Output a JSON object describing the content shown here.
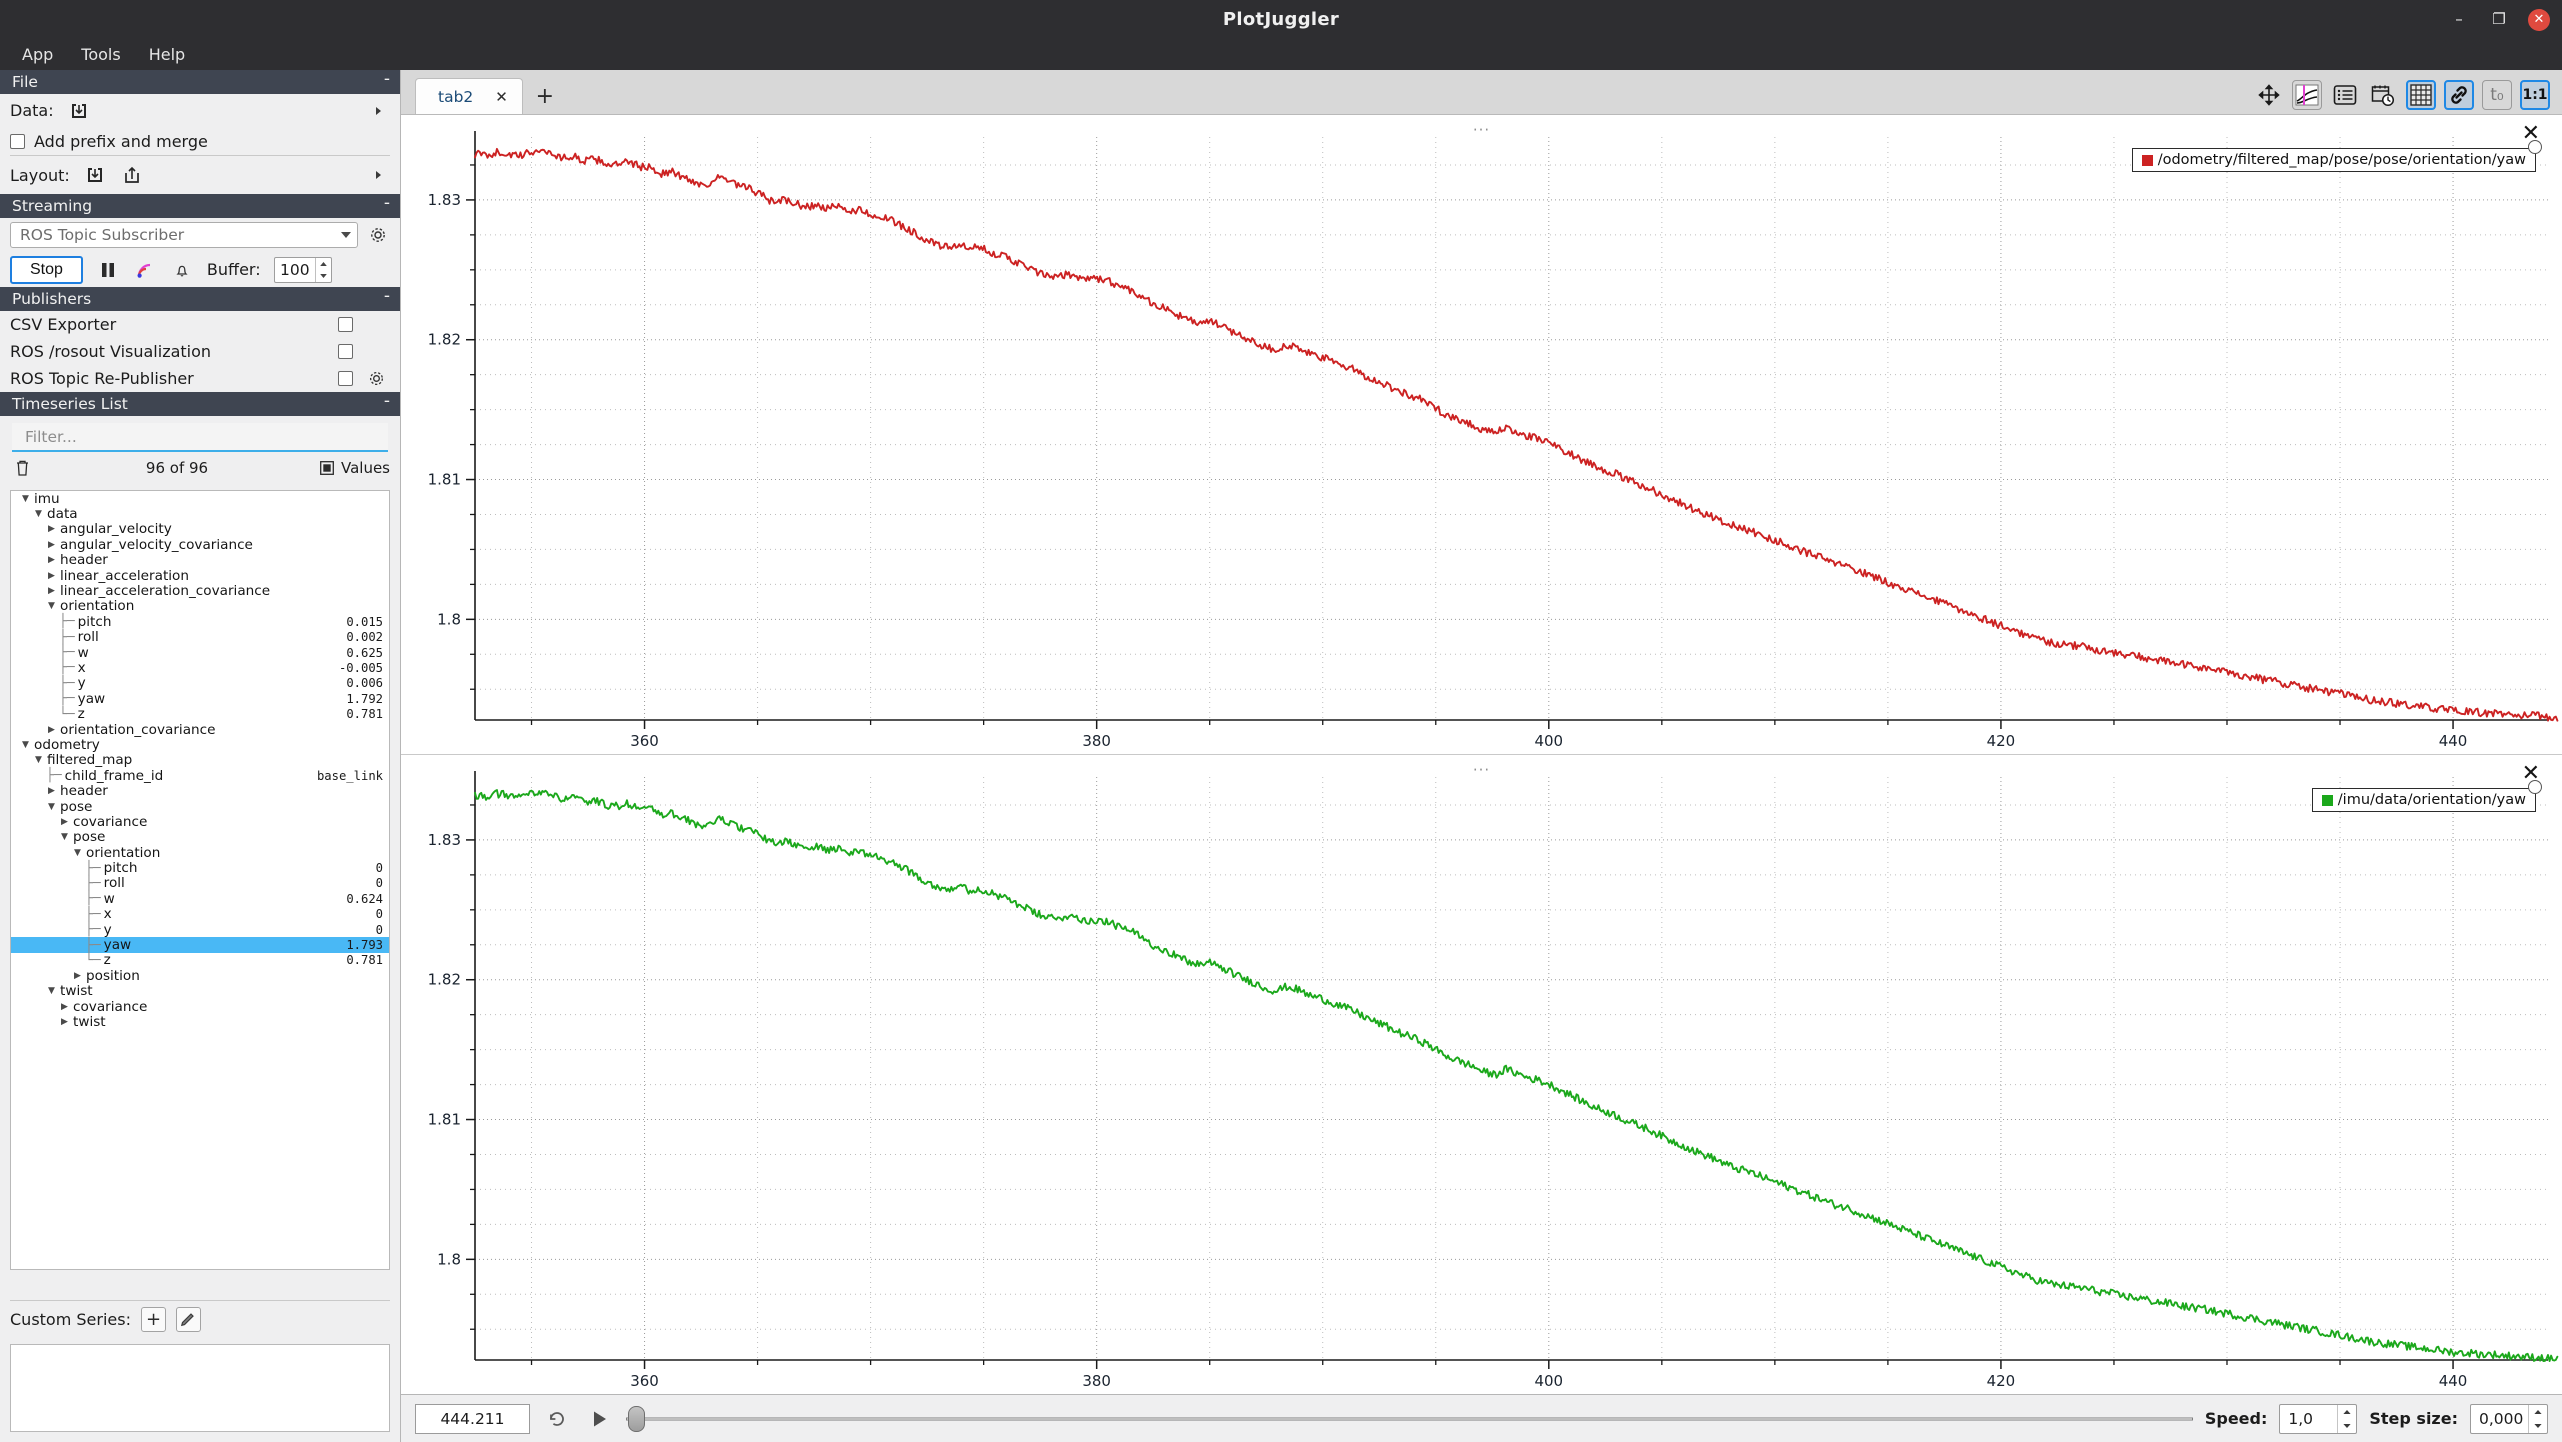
{
  "window": {
    "title": "PlotJuggler",
    "minimize": "–",
    "maximize": "❐",
    "close": "✕"
  },
  "menubar": {
    "items": [
      "App",
      "Tools",
      "Help"
    ]
  },
  "sidebar": {
    "file_section": {
      "title": "File",
      "collapse": "-",
      "data_label": "Data:",
      "add_prefix_label": "Add prefix and merge",
      "layout_label": "Layout:"
    },
    "streaming_section": {
      "title": "Streaming",
      "collapse": "-",
      "combo_value": "ROS Topic Subscriber",
      "stop_label": "Stop",
      "buffer_label": "Buffer:",
      "buffer_value": "100"
    },
    "publishers_section": {
      "title": "Publishers",
      "collapse": "-",
      "items": [
        {
          "label": "CSV Exporter",
          "has_gear": false
        },
        {
          "label": "ROS /rosout Visualization",
          "has_gear": false
        },
        {
          "label": "ROS Topic Re-Publisher",
          "has_gear": true
        }
      ]
    },
    "timeseries_section": {
      "title": "Timeseries List",
      "collapse": "-",
      "filter_placeholder": "Filter...",
      "count_label": "96 of 96",
      "values_label": "Values"
    },
    "custom_series": {
      "label": "Custom Series:",
      "add": "+",
      "edit": "✎"
    }
  },
  "tree": [
    {
      "depth": 0,
      "marker": "down",
      "label": "imu",
      "value": ""
    },
    {
      "depth": 1,
      "marker": "down",
      "label": "data",
      "value": ""
    },
    {
      "depth": 2,
      "marker": "right",
      "label": "angular_velocity",
      "value": ""
    },
    {
      "depth": 2,
      "marker": "right",
      "label": "angular_velocity_covariance",
      "value": ""
    },
    {
      "depth": 2,
      "marker": "right",
      "label": "header",
      "value": ""
    },
    {
      "depth": 2,
      "marker": "right",
      "label": "linear_acceleration",
      "value": ""
    },
    {
      "depth": 2,
      "marker": "right",
      "label": "linear_acceleration_covariance",
      "value": ""
    },
    {
      "depth": 2,
      "marker": "down",
      "label": "orientation",
      "value": ""
    },
    {
      "depth": 3,
      "marker": "tee",
      "label": "pitch",
      "value": "0.015"
    },
    {
      "depth": 3,
      "marker": "tee",
      "label": "roll",
      "value": "0.002"
    },
    {
      "depth": 3,
      "marker": "tee",
      "label": "w",
      "value": "0.625"
    },
    {
      "depth": 3,
      "marker": "tee",
      "label": "x",
      "value": "-0.005"
    },
    {
      "depth": 3,
      "marker": "tee",
      "label": "y",
      "value": "0.006"
    },
    {
      "depth": 3,
      "marker": "tee",
      "label": "yaw",
      "value": "1.792"
    },
    {
      "depth": 3,
      "marker": "end",
      "label": "z",
      "value": "0.781"
    },
    {
      "depth": 2,
      "marker": "right",
      "label": "orientation_covariance",
      "value": ""
    },
    {
      "depth": 0,
      "marker": "down",
      "label": "odometry",
      "value": ""
    },
    {
      "depth": 1,
      "marker": "down",
      "label": "filtered_map",
      "value": ""
    },
    {
      "depth": 2,
      "marker": "tee",
      "label": "child_frame_id",
      "value": "base_link"
    },
    {
      "depth": 2,
      "marker": "right",
      "label": "header",
      "value": ""
    },
    {
      "depth": 2,
      "marker": "down",
      "label": "pose",
      "value": ""
    },
    {
      "depth": 3,
      "marker": "right",
      "label": "covariance",
      "value": ""
    },
    {
      "depth": 3,
      "marker": "down",
      "label": "pose",
      "value": ""
    },
    {
      "depth": 4,
      "marker": "down",
      "label": "orientation",
      "value": ""
    },
    {
      "depth": 5,
      "marker": "tee",
      "label": "pitch",
      "value": "0"
    },
    {
      "depth": 5,
      "marker": "tee",
      "label": "roll",
      "value": "0"
    },
    {
      "depth": 5,
      "marker": "tee",
      "label": "w",
      "value": "0.624"
    },
    {
      "depth": 5,
      "marker": "tee",
      "label": "x",
      "value": "0"
    },
    {
      "depth": 5,
      "marker": "tee",
      "label": "y",
      "value": "0"
    },
    {
      "depth": 5,
      "marker": "tee",
      "label": "yaw",
      "value": "1.793",
      "selected": true
    },
    {
      "depth": 5,
      "marker": "end",
      "label": "z",
      "value": "0.781"
    },
    {
      "depth": 4,
      "marker": "right",
      "label": "position",
      "value": ""
    },
    {
      "depth": 2,
      "marker": "down",
      "label": "twist",
      "value": ""
    },
    {
      "depth": 3,
      "marker": "right",
      "label": "covariance",
      "value": ""
    },
    {
      "depth": 3,
      "marker": "right",
      "label": "twist",
      "value": ""
    }
  ],
  "tabs": {
    "items": [
      {
        "label": "tab2",
        "close": "✕",
        "active": true
      }
    ],
    "add": "+"
  },
  "toolbar": {
    "buttons": [
      {
        "name": "pan-icon",
        "active": false
      },
      {
        "name": "crosshair-icon",
        "active": false
      },
      {
        "name": "list-icon",
        "active": false
      },
      {
        "name": "calendar-clock-icon",
        "active": false
      },
      {
        "name": "grid-icon",
        "active": true
      },
      {
        "name": "link-icon",
        "active": true
      },
      {
        "name": "time-offset-icon",
        "active": false,
        "label": "t₀"
      },
      {
        "name": "ratio-icon",
        "active": true,
        "label": "1:1"
      }
    ]
  },
  "statusbar": {
    "time_value": "444.211",
    "loop_icon": "loop-icon",
    "play_icon": "play-icon",
    "speed_label": "Speed:",
    "speed_value": "1,0",
    "step_label": "Step size:",
    "step_value": "0,000"
  },
  "chart_data": [
    {
      "id": "plot-top",
      "type": "line",
      "title": "",
      "dots": "···",
      "series": [
        {
          "name": "/odometry/filtered_map/pose/pose/orientation/yaw",
          "color": "#cc2222"
        }
      ],
      "legend": {
        "position": "top-right"
      },
      "xlabel": "",
      "ylabel": "",
      "xlim": [
        352.5,
        444.2
      ],
      "ylim": [
        1.7928,
        1.8345
      ],
      "xticks": [
        360,
        380,
        400,
        420,
        440
      ],
      "yticks": [
        1.8,
        1.81,
        1.82,
        1.83
      ],
      "ytick_labels": [
        "1.8",
        "1.81",
        "1.82",
        "1.83"
      ],
      "grid": true,
      "values": [
        1.8333,
        1.8332,
        1.8334,
        1.8333,
        1.8331,
        1.8334,
        1.8336,
        1.8333,
        1.833,
        1.8331,
        1.8328,
        1.8329,
        1.8326,
        1.8325,
        1.8327,
        1.8324,
        1.8323,
        1.8319,
        1.832,
        1.8316,
        1.8313,
        1.831,
        1.8316,
        1.8314,
        1.831,
        1.8308,
        1.8304,
        1.8299,
        1.83,
        1.8298,
        1.8295,
        1.8296,
        1.8294,
        1.8295,
        1.8292,
        1.8293,
        1.829,
        1.8288,
        1.8285,
        1.8281,
        1.8277,
        1.8272,
        1.8268,
        1.8266,
        1.8268,
        1.8265,
        1.8266,
        1.8263,
        1.826,
        1.8257,
        1.8253,
        1.8249,
        1.8246,
        1.8244,
        1.8247,
        1.8245,
        1.8243,
        1.8244,
        1.8241,
        1.8238,
        1.8235,
        1.823,
        1.8225,
        1.8222,
        1.8218,
        1.8214,
        1.8212,
        1.8213,
        1.821,
        1.8206,
        1.8202,
        1.8199,
        1.8195,
        1.8193,
        1.8196,
        1.8194,
        1.819,
        1.8188,
        1.8185,
        1.8182,
        1.8179,
        1.8175,
        1.8171,
        1.8168,
        1.8164,
        1.8161,
        1.8158,
        1.8154,
        1.8149,
        1.8145,
        1.8142,
        1.8139,
        1.8135,
        1.8133,
        1.8137,
        1.8134,
        1.8131,
        1.8129,
        1.8126,
        1.8122,
        1.8118,
        1.8114,
        1.811,
        1.8107,
        1.8104,
        1.81,
        1.8097,
        1.8094,
        1.809,
        1.8086,
        1.8083,
        1.8079,
        1.8076,
        1.8073,
        1.8069,
        1.8066,
        1.8064,
        1.8061,
        1.8058,
        1.8055,
        1.8052,
        1.8049,
        1.8046,
        1.8043,
        1.804,
        1.8038,
        1.8035,
        1.8032,
        1.8029,
        1.8026,
        1.8023,
        1.802,
        1.8017,
        1.8014,
        1.8011,
        1.8008,
        1.8005,
        1.8002,
        1.7999,
        1.7996,
        1.7993,
        1.799,
        1.7987,
        1.7985,
        1.7983,
        1.7982,
        1.7981,
        1.798,
        1.7978,
        1.7977,
        1.7975,
        1.7974,
        1.7973,
        1.7971,
        1.797,
        1.7969,
        1.7967,
        1.7966,
        1.7965,
        1.7963,
        1.7962,
        1.796,
        1.7959,
        1.7957,
        1.7956,
        1.7954,
        1.7953,
        1.7951,
        1.795,
        1.7948,
        1.7947,
        1.7945,
        1.7944,
        1.7942,
        1.7941,
        1.794,
        1.7939,
        1.7938,
        1.7937,
        1.7936,
        1.7935,
        1.7934,
        1.7934,
        1.7933,
        1.7933,
        1.7932,
        1.7932,
        1.7931,
        1.7931,
        1.793
      ]
    },
    {
      "id": "plot-bottom",
      "type": "line",
      "title": "",
      "dots": "···",
      "series": [
        {
          "name": "/imu/data/orientation/yaw",
          "color": "#1ba81b"
        }
      ],
      "legend": {
        "position": "top-right"
      },
      "xlabel": "",
      "ylabel": "",
      "xlim": [
        352.5,
        444.2
      ],
      "ylim": [
        1.7928,
        1.8345
      ],
      "xticks": [
        360,
        380,
        400,
        420,
        440
      ],
      "yticks": [
        1.8,
        1.81,
        1.82,
        1.83
      ],
      "ytick_labels": [
        "1.8",
        "1.81",
        "1.82",
        "1.83"
      ],
      "grid": true,
      "values": [
        1.8332,
        1.8331,
        1.8333,
        1.8332,
        1.833,
        1.8333,
        1.8335,
        1.8332,
        1.8329,
        1.833,
        1.8327,
        1.8328,
        1.8325,
        1.8324,
        1.8326,
        1.8323,
        1.8322,
        1.8318,
        1.8319,
        1.8315,
        1.8312,
        1.8309,
        1.8315,
        1.8313,
        1.8309,
        1.8307,
        1.8303,
        1.8298,
        1.8299,
        1.8297,
        1.8294,
        1.8295,
        1.8293,
        1.8294,
        1.8291,
        1.8292,
        1.8289,
        1.8287,
        1.8284,
        1.828,
        1.8276,
        1.8271,
        1.8267,
        1.8265,
        1.8267,
        1.8264,
        1.8265,
        1.8262,
        1.8259,
        1.8256,
        1.8252,
        1.8248,
        1.8245,
        1.8243,
        1.8246,
        1.8244,
        1.8242,
        1.8243,
        1.824,
        1.8237,
        1.8234,
        1.8229,
        1.8224,
        1.8221,
        1.8217,
        1.8213,
        1.8211,
        1.8212,
        1.8209,
        1.8205,
        1.8201,
        1.8198,
        1.8194,
        1.8192,
        1.8195,
        1.8193,
        1.8189,
        1.8187,
        1.8184,
        1.8181,
        1.8178,
        1.8174,
        1.817,
        1.8167,
        1.8163,
        1.816,
        1.8157,
        1.8153,
        1.8148,
        1.8144,
        1.8141,
        1.8138,
        1.8134,
        1.8132,
        1.8136,
        1.8133,
        1.813,
        1.8128,
        1.8125,
        1.8121,
        1.8117,
        1.8113,
        1.8109,
        1.8106,
        1.8103,
        1.8099,
        1.8096,
        1.8093,
        1.8089,
        1.8085,
        1.8082,
        1.8078,
        1.8075,
        1.8072,
        1.8068,
        1.8065,
        1.8063,
        1.806,
        1.8057,
        1.8054,
        1.8051,
        1.8048,
        1.8045,
        1.8042,
        1.8039,
        1.8037,
        1.8034,
        1.8031,
        1.8028,
        1.8025,
        1.8022,
        1.8019,
        1.8016,
        1.8013,
        1.801,
        1.8007,
        1.8004,
        1.8001,
        1.7998,
        1.7995,
        1.7992,
        1.7989,
        1.7986,
        1.7984,
        1.7982,
        1.7981,
        1.798,
        1.7979,
        1.7977,
        1.7976,
        1.7974,
        1.7973,
        1.7972,
        1.797,
        1.7969,
        1.7968,
        1.7966,
        1.7965,
        1.7964,
        1.7962,
        1.7961,
        1.7959,
        1.7958,
        1.7956,
        1.7955,
        1.7953,
        1.7952,
        1.795,
        1.7949,
        1.7947,
        1.7946,
        1.7944,
        1.7943,
        1.7941,
        1.794,
        1.7939,
        1.7938,
        1.7937,
        1.7936,
        1.7935,
        1.7934,
        1.7933,
        1.7933,
        1.7932,
        1.7932,
        1.7931,
        1.7931,
        1.793,
        1.793,
        1.7929
      ]
    }
  ]
}
